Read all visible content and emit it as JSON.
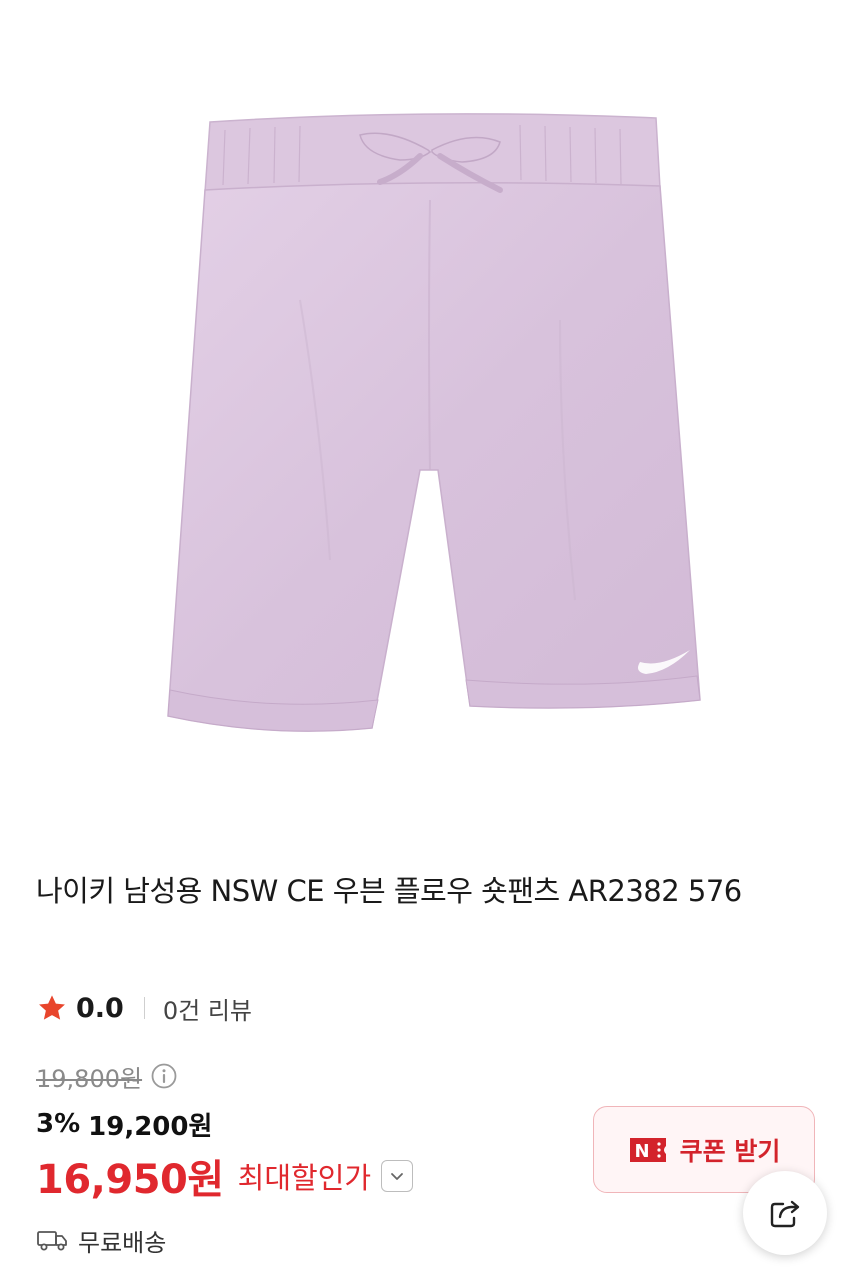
{
  "product": {
    "title": "나이키 남성용 NSW CE 우븐 플로우 숏팬츠 AR2382 576",
    "image_icon": "product-photo-purple-shorts"
  },
  "rating": {
    "value": "0.0",
    "review_count": "0건 리뷰",
    "star_color": "#e8452c"
  },
  "pricing": {
    "original_price": "19,800원",
    "discount_rate": "3%",
    "discount_price": "19,200원",
    "max_discount_price": "16,950원",
    "max_discount_label": "최대할인가",
    "accent_color": "#e0282e"
  },
  "coupon": {
    "label": "쿠폰 받기",
    "icon_letter": "N"
  },
  "shipping": {
    "label": "무료배송"
  },
  "icons": {
    "share": "share-icon",
    "info": "info-icon",
    "chevron": "chevron-down-icon",
    "truck": "truck-icon"
  }
}
